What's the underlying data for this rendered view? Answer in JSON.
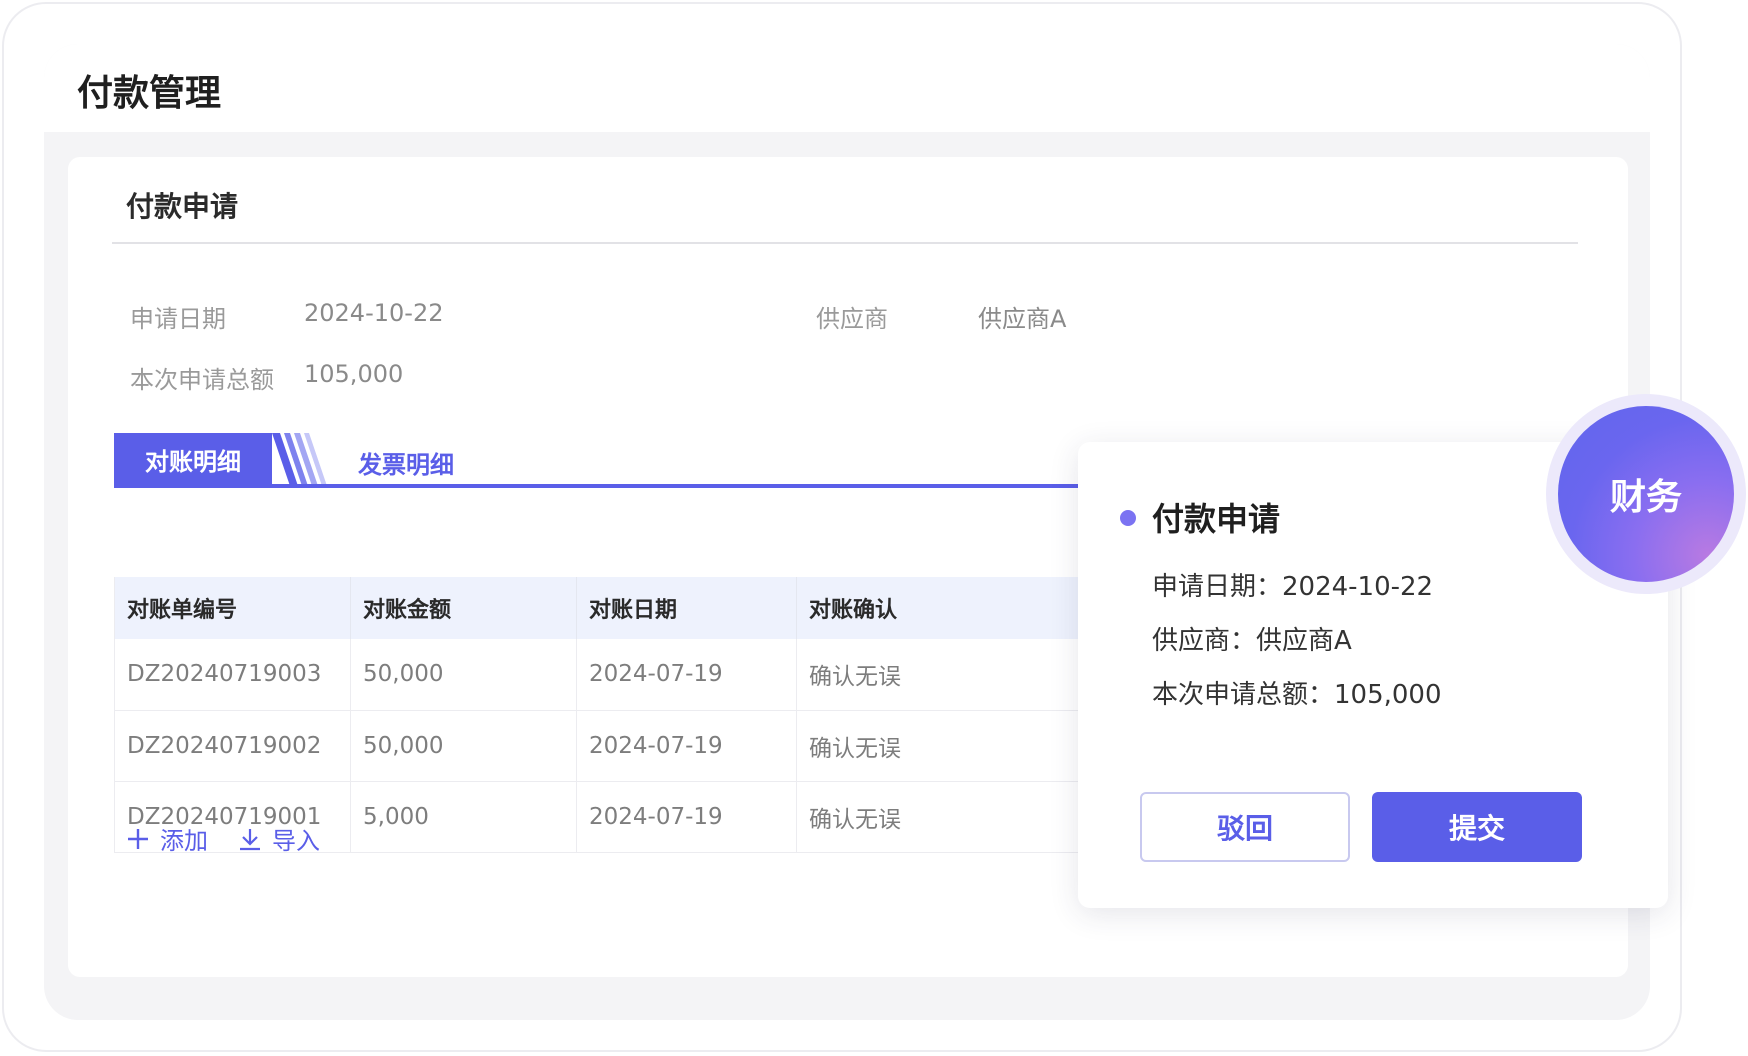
{
  "page": {
    "title": "付款管理"
  },
  "section": {
    "title": "付款申请"
  },
  "fields": {
    "apply_date_label": "申请日期",
    "apply_date_value": "2024-10-22",
    "supplier_label": "供应商",
    "supplier_value": "供应商A",
    "total_label": "本次申请总额",
    "total_value": "105,000"
  },
  "tabs": {
    "active": "对账明细",
    "inactive": "发票明细"
  },
  "table": {
    "headers": [
      "对账单编号",
      "对账金额",
      "对账日期",
      "对账确认"
    ],
    "rows": [
      [
        "DZ20240719003",
        "50,000",
        "2024-07-19",
        "确认无误"
      ],
      [
        "DZ20240719002",
        "50,000",
        "2024-07-19",
        "确认无误"
      ],
      [
        "DZ20240719001",
        "5,000",
        "2024-07-19",
        "确认无误"
      ]
    ]
  },
  "actions": {
    "add_label": "添加",
    "import_label": "导入"
  },
  "popup": {
    "title": "付款申请",
    "apply_date_line": "申请日期：2024-10-22",
    "supplier_line": "供应商：供应商A",
    "total_line": "本次申请总额：105,000",
    "reject_label": "驳回",
    "submit_label": "提交"
  },
  "role_badge": {
    "label": "财务"
  },
  "colors": {
    "accent": "#5a5ee8",
    "table_header_bg": "#eef2fd",
    "badge_gradient_end": "#b87ae2"
  },
  "icons": {
    "add": "plus-icon",
    "import": "download-icon",
    "popup_bullet": "dot-icon"
  }
}
